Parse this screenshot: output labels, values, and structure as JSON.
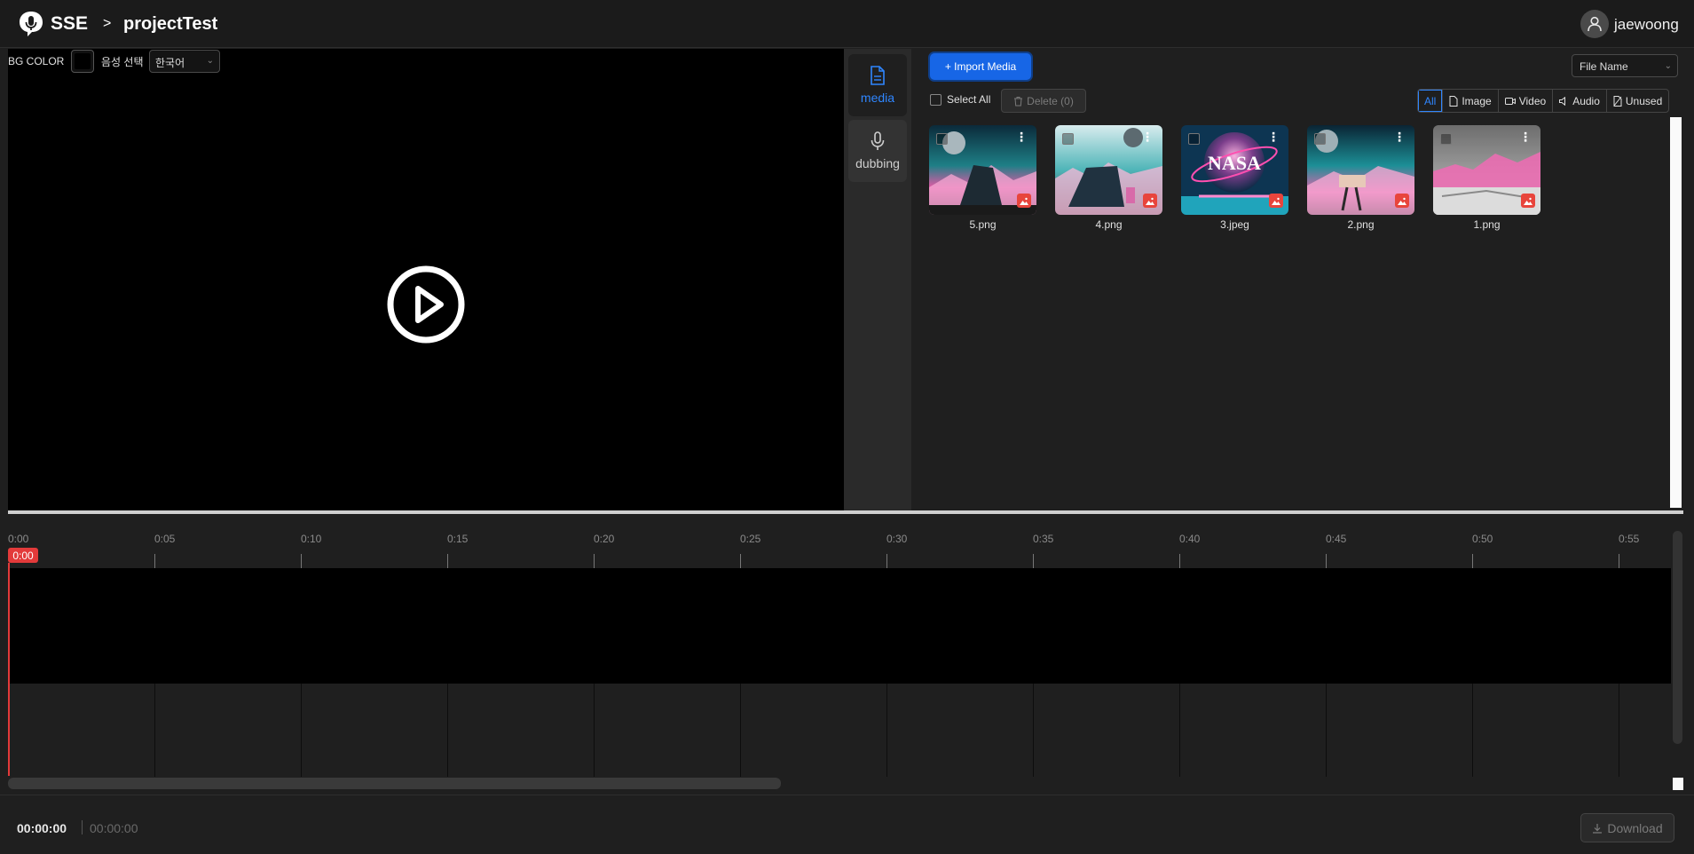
{
  "header": {
    "brand": "SSE",
    "breadcrumb_sep": ">",
    "project_name": "projectTest",
    "username": "jaewoong",
    "icons": {
      "logo": "mic-bubble-icon",
      "avatar": "user-icon"
    }
  },
  "preview": {
    "bg_color_label": "BG COLOR",
    "bg_color_value": "#000000",
    "voice_label": "음성 선택",
    "language_selected": "한국어",
    "play_icon": "play-circle-icon"
  },
  "sidetabs": [
    {
      "label": "media",
      "icon": "file-icon",
      "active": true
    },
    {
      "label": "dubbing",
      "icon": "mic-icon",
      "active": false
    }
  ],
  "media_panel": {
    "import_label": "+ Import Media",
    "sort_selected": "File Name",
    "select_all_label": "Select All",
    "delete_label": "Delete (0)",
    "filters": [
      {
        "label": "All",
        "active": true
      },
      {
        "label": "Image",
        "icon": "file-icon"
      },
      {
        "label": "Video",
        "icon": "video-icon"
      },
      {
        "label": "Audio",
        "icon": "speaker-icon"
      },
      {
        "label": "Unused",
        "icon": "unused-icon"
      }
    ],
    "items": [
      {
        "name": "5.png"
      },
      {
        "name": "4.png"
      },
      {
        "name": "3.jpeg",
        "overlay_text": "NASA"
      },
      {
        "name": "2.png"
      },
      {
        "name": "1.png"
      }
    ]
  },
  "timeline": {
    "ticks": [
      "0:00",
      "0:05",
      "0:10",
      "0:15",
      "0:20",
      "0:25",
      "0:30",
      "0:35",
      "0:40",
      "0:45",
      "0:50",
      "0:55"
    ],
    "playhead": "0:00"
  },
  "footer": {
    "current_time": "00:00:00",
    "total_time": "00:00:00",
    "download_label": "Download"
  },
  "colors": {
    "accent": "#1766e6",
    "playhead": "#e33a3a",
    "badge": "#e8453c"
  }
}
